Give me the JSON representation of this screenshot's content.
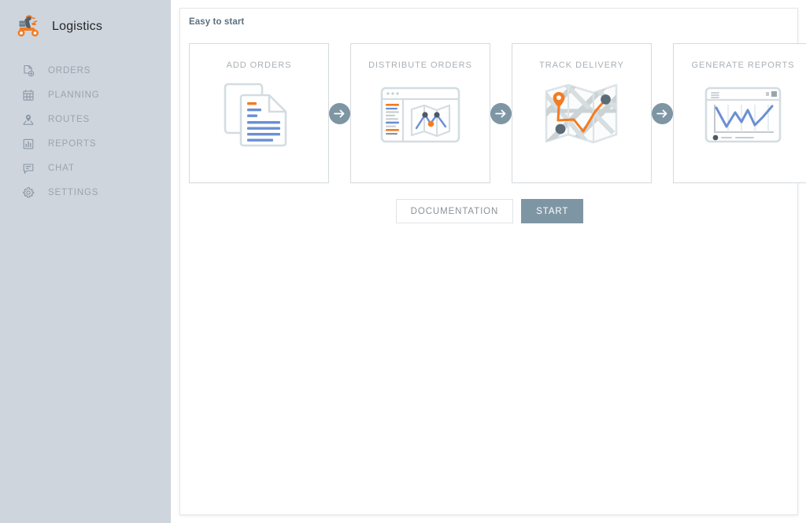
{
  "app": {
    "brand_title": "Logistics",
    "logo_icon": "delivery-scooter-icon"
  },
  "sidebar": {
    "items": [
      {
        "label": "ORDERS",
        "icon": "document-plus-icon"
      },
      {
        "label": "PLANNING",
        "icon": "calendar-icon"
      },
      {
        "label": "ROUTES",
        "icon": "person-location-icon"
      },
      {
        "label": "REPORTS",
        "icon": "bar-chart-icon"
      },
      {
        "label": "CHAT",
        "icon": "chat-bubble-icon"
      },
      {
        "label": "SETTINGS",
        "icon": "gear-icon"
      }
    ]
  },
  "main": {
    "panel_title": "Easy to start",
    "cards": [
      {
        "title": "ADD ORDERS",
        "art": "documents-illustration"
      },
      {
        "title": "DISTRIBUTE ORDERS",
        "art": "browser-map-illustration"
      },
      {
        "title": "TRACK DELIVERY",
        "art": "folded-map-route-illustration"
      },
      {
        "title": "GENERATE REPORTS",
        "art": "dashboard-chart-illustration"
      }
    ],
    "arrow_icon": "arrow-right-icon",
    "buttons": {
      "documentation": "DOCUMENTATION",
      "start": "START"
    }
  },
  "colors": {
    "sidebar_bg": "#ced5dd",
    "accent_orange": "#f47b20",
    "accent_blue": "#6b8fd4",
    "slate": "#7e95a4",
    "panel_title": "#5d7080"
  }
}
